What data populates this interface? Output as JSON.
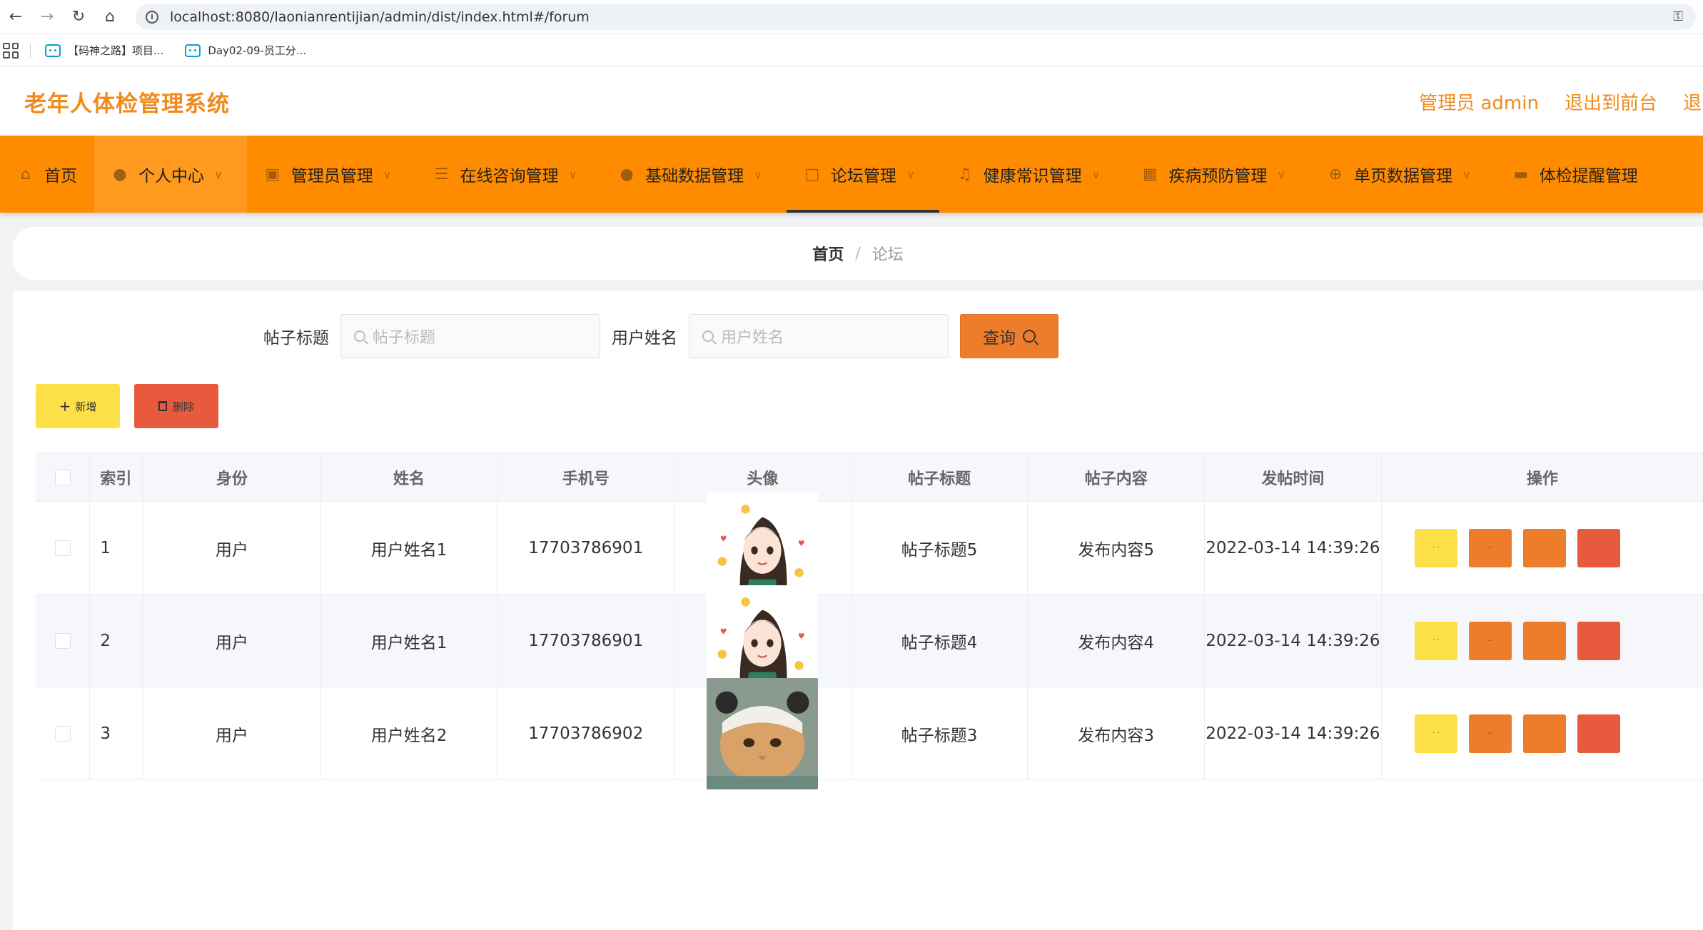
{
  "browser": {
    "url": "localhost:8080/laonianrentijian/admin/dist/index.html#/forum",
    "bookmarks": [
      "【码神之路】项目...",
      "Day02-09-员工分..."
    ]
  },
  "header": {
    "title": "老年人体检管理系统",
    "user": "管理员 admin",
    "front": "退出到前台",
    "logout": "退出"
  },
  "nav": [
    {
      "label": "首页",
      "icon": "home-icon"
    },
    {
      "label": "个人中心",
      "icon": "user-icon"
    },
    {
      "label": "管理员管理",
      "icon": "clipboard-icon"
    },
    {
      "label": "在线咨询管理",
      "icon": "menu-icon"
    },
    {
      "label": "基础数据管理",
      "icon": "location-icon"
    },
    {
      "label": "论坛管理",
      "icon": "document-icon"
    },
    {
      "label": "健康常识管理",
      "icon": "bell-icon"
    },
    {
      "label": "疾病预防管理",
      "icon": "grid-icon"
    },
    {
      "label": "单页数据管理",
      "icon": "globe-icon"
    },
    {
      "label": "体检提醒管理",
      "icon": "briefcase-icon"
    }
  ],
  "breadcrumb": {
    "home": "首页",
    "current": "论坛"
  },
  "search": {
    "title_label": "帖子标题",
    "title_placeholder": "帖子标题",
    "user_label": "用户姓名",
    "user_placeholder": "用户姓名",
    "query": "查询"
  },
  "actions": {
    "add": "新增",
    "delete": "删除"
  },
  "table": {
    "columns": [
      "索引",
      "身份",
      "姓名",
      "手机号",
      "头像",
      "帖子标题",
      "帖子内容",
      "发帖时间",
      "操作"
    ],
    "rows": [
      {
        "index": "1",
        "role": "用户",
        "name": "用户姓名1",
        "phone": "17703786901",
        "avatar": "girl-avatar",
        "title": "帖子标题5",
        "content": "发布内容5",
        "time": "2022-03-14 14:39:26"
      },
      {
        "index": "2",
        "role": "用户",
        "name": "用户姓名1",
        "phone": "17703786901",
        "avatar": "girl-avatar",
        "title": "帖子标题4",
        "content": "发布内容4",
        "time": "2022-03-14 14:39:26"
      },
      {
        "index": "3",
        "role": "用户",
        "name": "用户姓名2",
        "phone": "17703786902",
        "avatar": "cat-avatar",
        "title": "帖子标题3",
        "content": "发布内容3",
        "time": "2022-03-14 14:39:26"
      }
    ]
  },
  "colors": {
    "brand": "#ff8c00",
    "title": "#f08a1c",
    "query": "#ee7d2b",
    "add": "#fde047",
    "delete": "#e85a3d"
  }
}
